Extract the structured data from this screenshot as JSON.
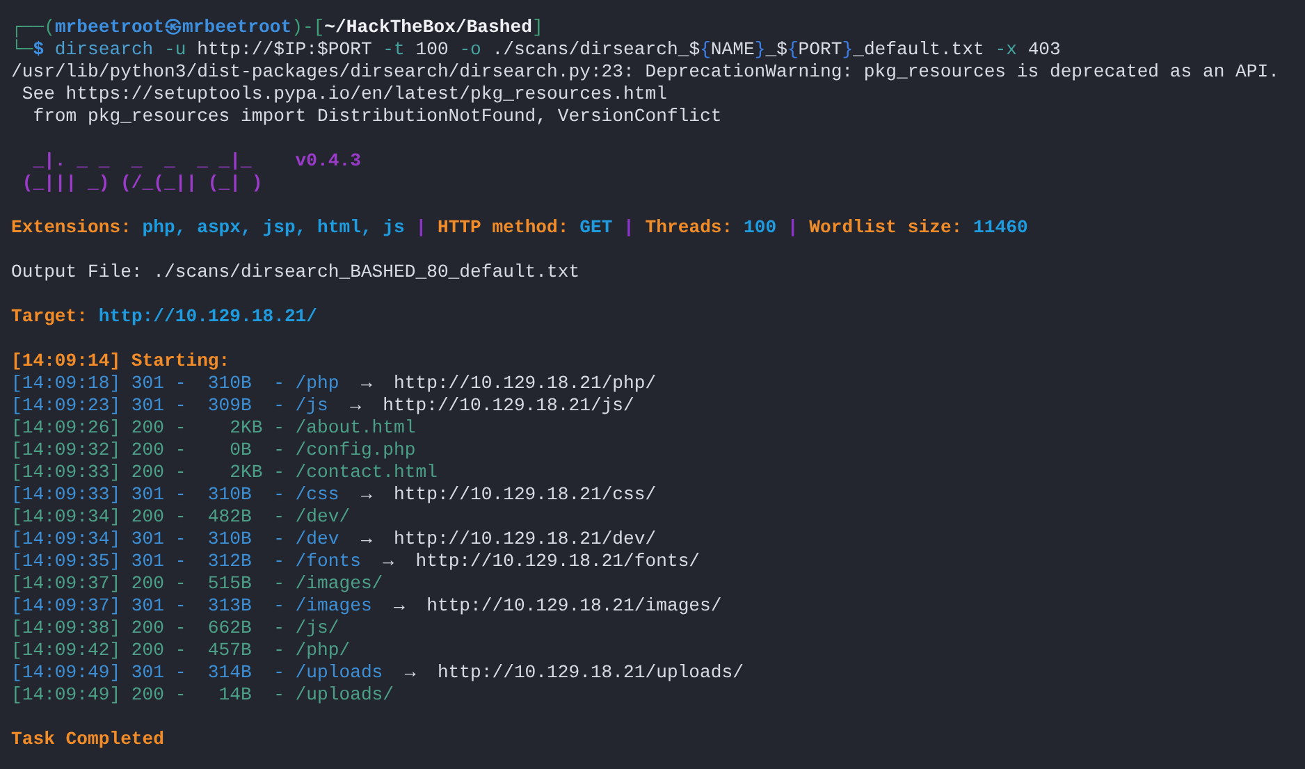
{
  "terminal": {
    "lines": [
      {
        "kind": "prompt",
        "segments": [
          {
            "text": "┌──(",
            "kind": "frame"
          },
          {
            "text": "mrbeetroot㉿mrbeetroot",
            "kind": "user"
          },
          {
            "text": ")-[",
            "kind": "frame"
          },
          {
            "text": "~/HackTheBox/Bashed",
            "kind": "path"
          },
          {
            "text": "]",
            "kind": "frame"
          }
        ]
      },
      {
        "kind": "command",
        "segments": [
          {
            "text": "└─",
            "kind": "frame"
          },
          {
            "text": "$",
            "kind": "dollar"
          },
          {
            "text": " dirsearch",
            "kind": "cmd"
          },
          {
            "text": " -u",
            "kind": "flag"
          },
          {
            "text": " http://$IP:$PORT ",
            "kind": "plain"
          },
          {
            "text": "-t",
            "kind": "flag"
          },
          {
            "text": " 100 ",
            "kind": "plain"
          },
          {
            "text": "-o",
            "kind": "flag"
          },
          {
            "text": " ./scans/dirsearch_$",
            "kind": "plain"
          },
          {
            "text": "{",
            "kind": "brace"
          },
          {
            "text": "NAME",
            "kind": "plain"
          },
          {
            "text": "}",
            "kind": "brace"
          },
          {
            "text": "_$",
            "kind": "plain"
          },
          {
            "text": "{",
            "kind": "brace"
          },
          {
            "text": "PORT",
            "kind": "plain"
          },
          {
            "text": "}",
            "kind": "brace"
          },
          {
            "text": "_default.txt ",
            "kind": "plain"
          },
          {
            "text": "-x",
            "kind": "flag"
          },
          {
            "text": " 403",
            "kind": "plain"
          }
        ]
      },
      {
        "kind": "warning",
        "segments": [
          {
            "text": "/usr/lib/python3/dist-packages/dirsearch/dirsearch.py:23: DeprecationWarning: pkg_resources is deprecated as an API.",
            "kind": "plain"
          }
        ]
      },
      {
        "kind": "warning",
        "segments": [
          {
            "text": " See https://setuptools.pypa.io/en/latest/pkg_resources.html",
            "kind": "plain"
          }
        ]
      },
      {
        "kind": "warning",
        "segments": [
          {
            "text": "  from pkg_resources import DistributionNotFound, VersionConflict",
            "kind": "plain"
          }
        ]
      },
      {
        "kind": "banner",
        "art": [
          "_|. _ _  _  _  _ _|_",
          "(_||| _) (/_(_|| (_| )"
        ],
        "version": "v0.4.3"
      },
      {
        "kind": "config",
        "segments": [
          {
            "text": "Extensions: ",
            "kind": "label"
          },
          {
            "text": "php, aspx, jsp, html, js",
            "kind": "value"
          },
          {
            "text": " | ",
            "kind": "pipe"
          },
          {
            "text": "HTTP method: ",
            "kind": "label"
          },
          {
            "text": "GET",
            "kind": "value"
          },
          {
            "text": " | ",
            "kind": "pipe"
          },
          {
            "text": "Threads: ",
            "kind": "label"
          },
          {
            "text": "100",
            "kind": "value"
          },
          {
            "text": " | ",
            "kind": "pipe"
          },
          {
            "text": "Wordlist size: ",
            "kind": "label"
          },
          {
            "text": "11460",
            "kind": "value"
          }
        ]
      },
      {
        "kind": "output",
        "segments": [
          {
            "text": "Output File: ./scans/dirsearch_BASHED_80_default.txt",
            "kind": "plain"
          }
        ]
      },
      {
        "kind": "target",
        "segments": [
          {
            "text": "Target: ",
            "kind": "label"
          },
          {
            "text": "http://10.129.18.21/",
            "kind": "value"
          }
        ]
      },
      {
        "kind": "start",
        "segments": [
          {
            "text": "[14:09:14] Starting:",
            "kind": "label"
          }
        ]
      },
      {
        "kind": "result",
        "segments": [
          {
            "text": "[14:09:18] 301 -  310B  - /php",
            "kind": "redirect"
          },
          {
            "text": "  →  http://10.129.18.21/php/",
            "kind": "plain"
          }
        ]
      },
      {
        "kind": "result",
        "segments": [
          {
            "text": "[14:09:23] 301 -  309B  - /js",
            "kind": "redirect"
          },
          {
            "text": "  →  http://10.129.18.21/js/",
            "kind": "plain"
          }
        ]
      },
      {
        "kind": "result",
        "segments": [
          {
            "text": "[14:09:26] 200 -    2KB - /about.html",
            "kind": "ok"
          }
        ]
      },
      {
        "kind": "result",
        "segments": [
          {
            "text": "[14:09:32] 200 -    0B  - /config.php",
            "kind": "ok"
          }
        ]
      },
      {
        "kind": "result",
        "segments": [
          {
            "text": "[14:09:33] 200 -    2KB - /contact.html",
            "kind": "ok"
          }
        ]
      },
      {
        "kind": "result",
        "segments": [
          {
            "text": "[14:09:33] 301 -  310B  - /css",
            "kind": "redirect"
          },
          {
            "text": "  →  http://10.129.18.21/css/",
            "kind": "plain"
          }
        ]
      },
      {
        "kind": "result",
        "segments": [
          {
            "text": "[14:09:34] 200 -  482B  - /dev/",
            "kind": "ok"
          }
        ]
      },
      {
        "kind": "result",
        "segments": [
          {
            "text": "[14:09:34] 301 -  310B  - /dev",
            "kind": "redirect"
          },
          {
            "text": "  →  http://10.129.18.21/dev/",
            "kind": "plain"
          }
        ]
      },
      {
        "kind": "result",
        "segments": [
          {
            "text": "[14:09:35] 301 -  312B  - /fonts",
            "kind": "redirect"
          },
          {
            "text": "  →  http://10.129.18.21/fonts/",
            "kind": "plain"
          }
        ]
      },
      {
        "kind": "result",
        "segments": [
          {
            "text": "[14:09:37] 200 -  515B  - /images/",
            "kind": "ok"
          }
        ]
      },
      {
        "kind": "result",
        "segments": [
          {
            "text": "[14:09:37] 301 -  313B  - /images",
            "kind": "redirect"
          },
          {
            "text": "  →  http://10.129.18.21/images/",
            "kind": "plain"
          }
        ]
      },
      {
        "kind": "result",
        "segments": [
          {
            "text": "[14:09:38] 200 -  662B  - /js/",
            "kind": "ok"
          }
        ]
      },
      {
        "kind": "result",
        "segments": [
          {
            "text": "[14:09:42] 200 -  457B  - /php/",
            "kind": "ok"
          }
        ]
      },
      {
        "kind": "result",
        "segments": [
          {
            "text": "[14:09:49] 301 -  314B  - /uploads",
            "kind": "redirect"
          },
          {
            "text": "  →  http://10.129.18.21/uploads/",
            "kind": "plain"
          }
        ]
      },
      {
        "kind": "result",
        "segments": [
          {
            "text": "[14:09:49] 200 -   14B  - /uploads/",
            "kind": "ok"
          }
        ]
      },
      {
        "kind": "done",
        "segments": [
          {
            "text": "Task Completed",
            "kind": "label"
          }
        ]
      }
    ]
  }
}
